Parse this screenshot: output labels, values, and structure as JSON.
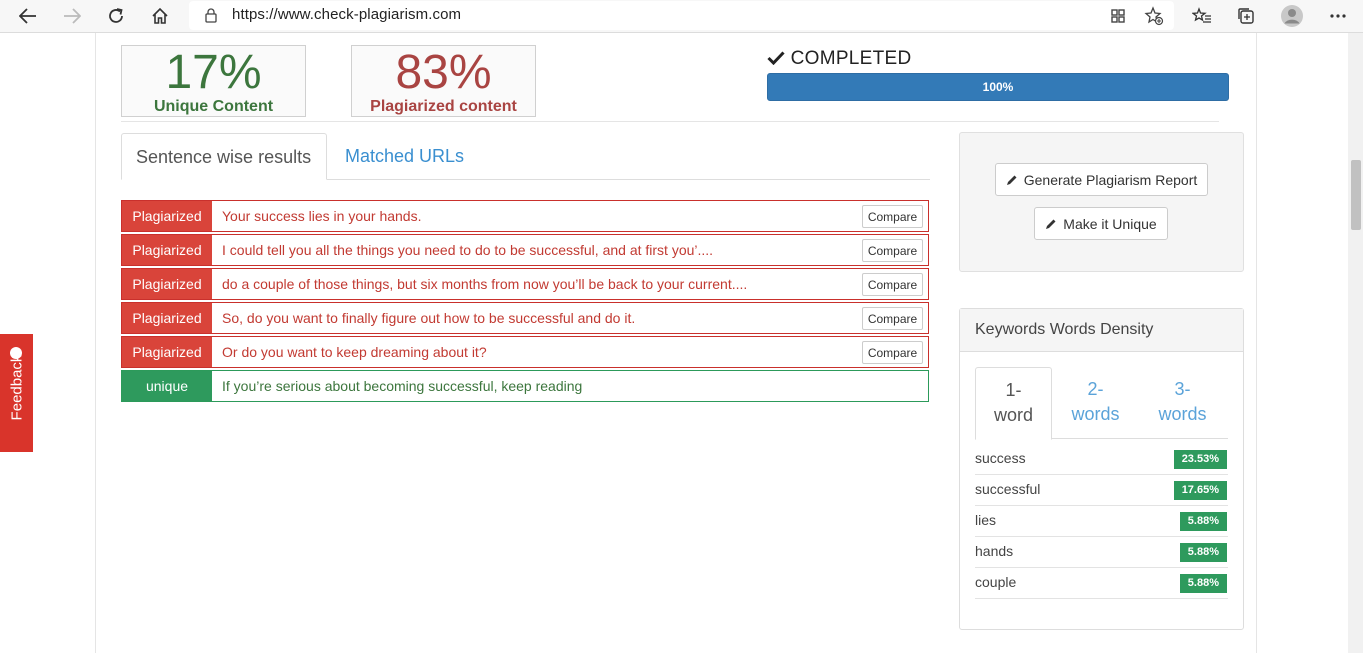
{
  "browser": {
    "url": "https://www.check-plagiarism.com"
  },
  "stats": {
    "unique_pct": "17%",
    "unique_label": "Unique Content",
    "plag_pct": "83%",
    "plag_label": "Plagiarized content"
  },
  "status": {
    "text": "COMPLETED",
    "progress_label": "100%",
    "progress_fraction": 1.0
  },
  "tabs": {
    "sentence": "Sentence wise results",
    "urls": "Matched URLs"
  },
  "results": [
    {
      "status": "Plagiarized",
      "text": "Your success lies in your hands.",
      "compare": "Compare"
    },
    {
      "status": "Plagiarized",
      "text": "I could tell you all the things you need to do to be successful, and at first you’....",
      "compare": "Compare"
    },
    {
      "status": "Plagiarized",
      "text": "do a couple of those things, but six months from now you’ll be back to your current....",
      "compare": "Compare"
    },
    {
      "status": "Plagiarized",
      "text": "So, do you want to finally figure out how to be successful and do it.",
      "compare": "Compare"
    },
    {
      "status": "Plagiarized",
      "text": "Or do you want to keep dreaming about it?",
      "compare": "Compare"
    },
    {
      "status": "unique",
      "text": "If you’re serious about becoming successful, keep reading",
      "compare": ""
    }
  ],
  "actions": {
    "report": "Generate Plagiarism Report",
    "unique": "Make it Unique"
  },
  "keywords": {
    "title": "Keywords Words Density",
    "tabs": [
      "1-\nword",
      "2-\nwords",
      "3-\nwords"
    ],
    "tab_lines": [
      [
        "1-",
        "word"
      ],
      [
        "2-",
        "words"
      ],
      [
        "3-",
        "words"
      ]
    ],
    "items": [
      {
        "word": "success",
        "density": "23.53%"
      },
      {
        "word": "successful",
        "density": "17.65%"
      },
      {
        "word": "lies",
        "density": "5.88%"
      },
      {
        "word": "hands",
        "density": "5.88%"
      },
      {
        "word": "couple",
        "density": "5.88%"
      }
    ]
  },
  "feedback": {
    "label": "Feedback"
  },
  "colors": {
    "plagiarized": "#d9443a",
    "unique": "#2e9a5d",
    "progress": "#337ab7"
  }
}
